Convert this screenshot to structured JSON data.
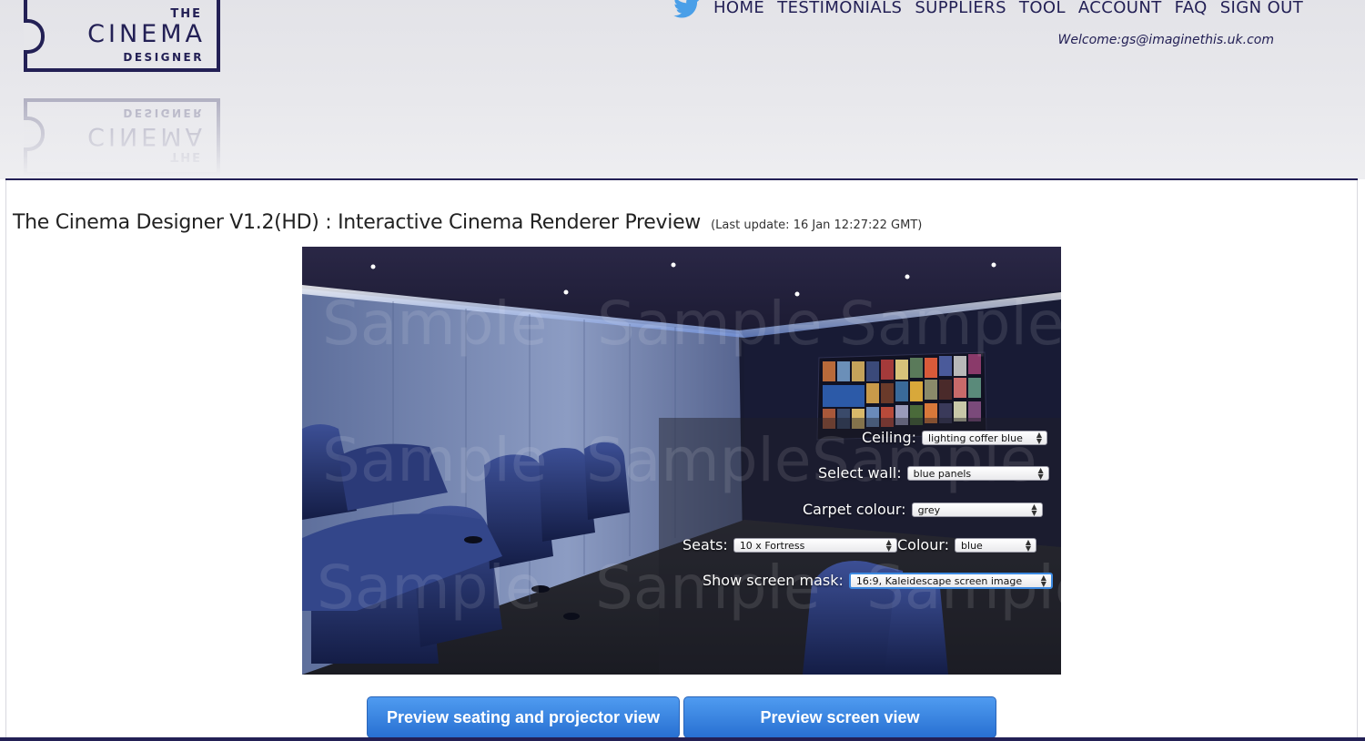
{
  "logo": {
    "the": "THE",
    "cinema": "CINEMA",
    "designer": "DESIGNER"
  },
  "nav": {
    "items": [
      "HOME",
      "TESTIMONIALS",
      "SUPPLIERS",
      "TOOL",
      "ACCOUNT",
      "FAQ",
      "SIGN OUT"
    ],
    "welcome": "Welcome:gs@imaginethis.uk.com"
  },
  "page": {
    "title": "The Cinema Designer V1.2(HD) : Interactive Cinema Renderer Preview",
    "last_update": "(Last update: 16 Jan 12:27:22 GMT)"
  },
  "renderer": {
    "watermark": "Sample",
    "controls": {
      "ceiling": {
        "label": "Ceiling:",
        "value": "lighting coffer blue"
      },
      "wall": {
        "label": "Select wall:",
        "value": "blue panels"
      },
      "carpet": {
        "label": "Carpet colour:",
        "value": "grey"
      },
      "seats": {
        "label": "Seats:",
        "value": "10 x Fortress"
      },
      "colour": {
        "label": "Colour:",
        "value": "blue"
      },
      "mask": {
        "label": "Show screen mask:",
        "value": "16:9, Kaleidescape screen image"
      }
    }
  },
  "buttons": {
    "seating": "Preview seating and projector view",
    "screen": "Preview screen view"
  },
  "colors": {
    "brand": "#232055",
    "button": "#3a86e6",
    "twitter": "#4a9fe8"
  }
}
